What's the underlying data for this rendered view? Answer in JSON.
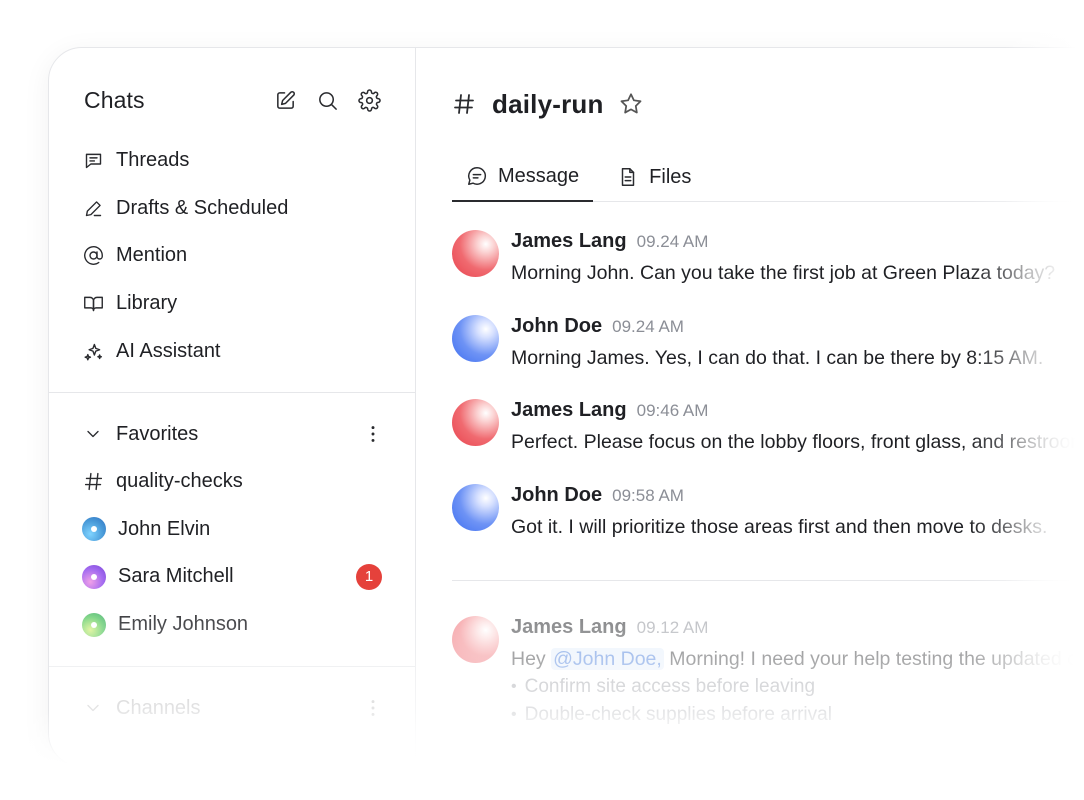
{
  "sidebar": {
    "title": "Chats",
    "nav": [
      {
        "label": "Threads",
        "icon": "threads-icon"
      },
      {
        "label": "Drafts & Scheduled",
        "icon": "pen-icon"
      },
      {
        "label": "Mention",
        "icon": "at-sign-icon"
      },
      {
        "label": "Library",
        "icon": "book-icon"
      },
      {
        "label": "AI Assistant",
        "icon": "sparkles-icon"
      }
    ],
    "favorites": {
      "label": "Favorites",
      "items": [
        {
          "label": "quality-checks",
          "type": "channel"
        },
        {
          "label": "John Elvin",
          "type": "dm",
          "avatar_color": "#4a9bd9"
        },
        {
          "label": "Sara Mitchell",
          "type": "dm",
          "avatar_color": "#a46cf0",
          "badge": "1"
        },
        {
          "label": "Emily Johnson",
          "type": "dm",
          "avatar_color": "#6ccf74"
        }
      ]
    },
    "channels": {
      "label": "Channels"
    }
  },
  "channel": {
    "name": "daily-run",
    "tabs": [
      {
        "label": "Message",
        "active": true
      },
      {
        "label": "Files",
        "active": false
      }
    ]
  },
  "messages": [
    {
      "author": "James Lang",
      "time": "09.24 AM",
      "avatar": "red",
      "text": "Morning John. Can you take the first job at Green Plaza today?"
    },
    {
      "author": "John Doe",
      "time": "09.24 AM",
      "avatar": "blue",
      "text": "Morning James. Yes, I can do that. I can be there by 8:15 AM."
    },
    {
      "author": "James Lang",
      "time": "09:46 AM",
      "avatar": "red",
      "text": "Perfect. Please focus on the lobby floors, front glass, and restrooms."
    },
    {
      "author": "John Doe",
      "time": "09:58 AM",
      "avatar": "blue",
      "text": "Got it. I will prioritize those areas first and then move to desks."
    }
  ],
  "latest_message": {
    "author": "James Lang",
    "time": "09.12 AM",
    "prefix": "Hey ",
    "mention": "@John Doe,",
    "text": " Morning! I need your help testing the updated checklist.",
    "bullets": [
      "Confirm site access before leaving",
      "Double-check supplies before arrival"
    ]
  },
  "colors": {
    "badge": "#e5413b",
    "mention_bg": "#e2ecfb",
    "mention_text": "#2f6bd6",
    "avatar_red": "#e8434e",
    "avatar_blue": "#3d6ef0"
  }
}
